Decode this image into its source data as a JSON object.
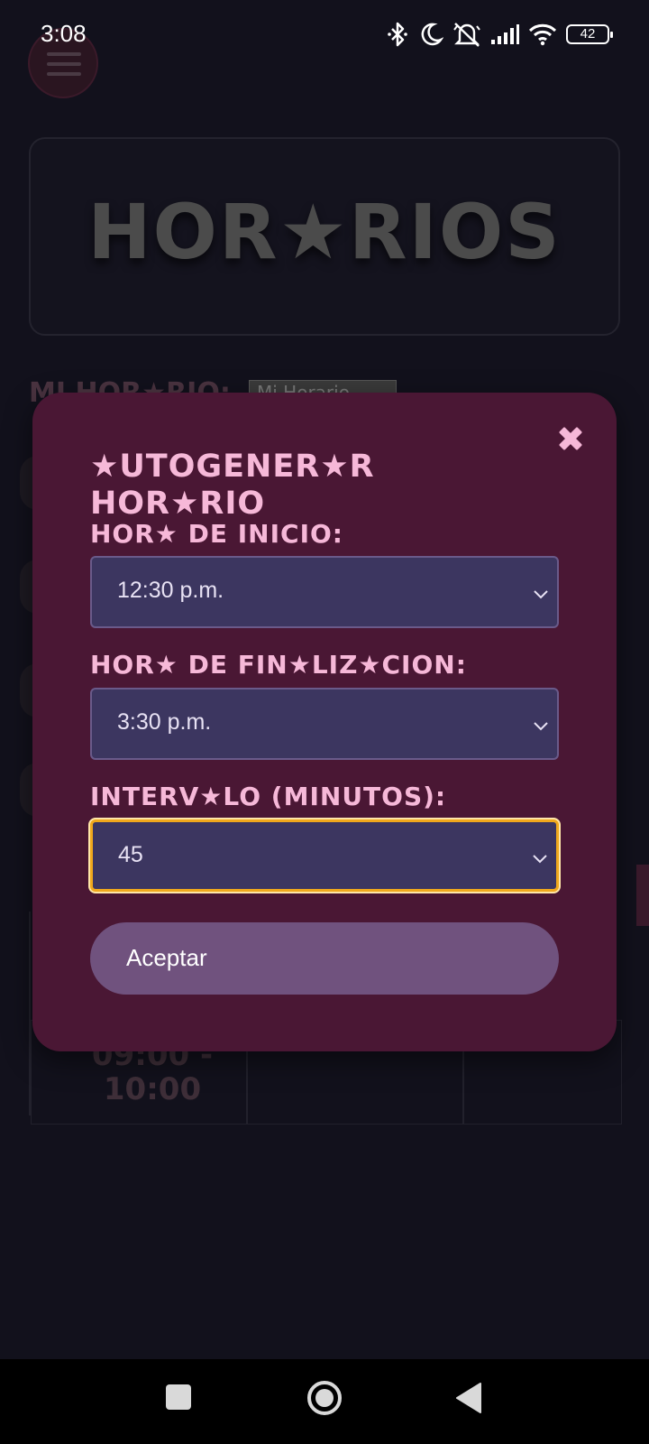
{
  "status_bar": {
    "time": "3:08",
    "battery": "42",
    "icons": [
      "bluetooth-icon",
      "moon-icon",
      "mute-icon",
      "signal-icon",
      "wifi-icon",
      "battery-icon"
    ]
  },
  "background": {
    "menu_icon": "hamburger-icon",
    "header_title": "HOR★RIOS",
    "schedule_label": "MI HOR★RIO:",
    "schedule_select_value": "Mi Horario",
    "table_time": "09:00 -\n10:00"
  },
  "modal": {
    "title": "★UTOGENER★R HOR★RIO",
    "close_icon": "close-icon",
    "fields": [
      {
        "label": "HOR★ DE INICIO:",
        "value": "12:30 p.m."
      },
      {
        "label": "HOR★ DE FIN★LIZ★CION:",
        "value": "3:30 p.m."
      },
      {
        "label": "INTERV★LO (MINUTOS):",
        "value": "45"
      }
    ],
    "accept_label": "Aceptar"
  },
  "colors": {
    "modal_bg": "#4a1734",
    "label_pink": "#f6b8d8",
    "select_bg": "#3c3660",
    "focus_ring": "#f0a81c",
    "button_bg": "#70527e",
    "page_bg": "#12111c"
  },
  "nav_bar": {
    "icons": [
      "recents-square-icon",
      "home-circle-icon",
      "back-triangle-icon"
    ]
  }
}
